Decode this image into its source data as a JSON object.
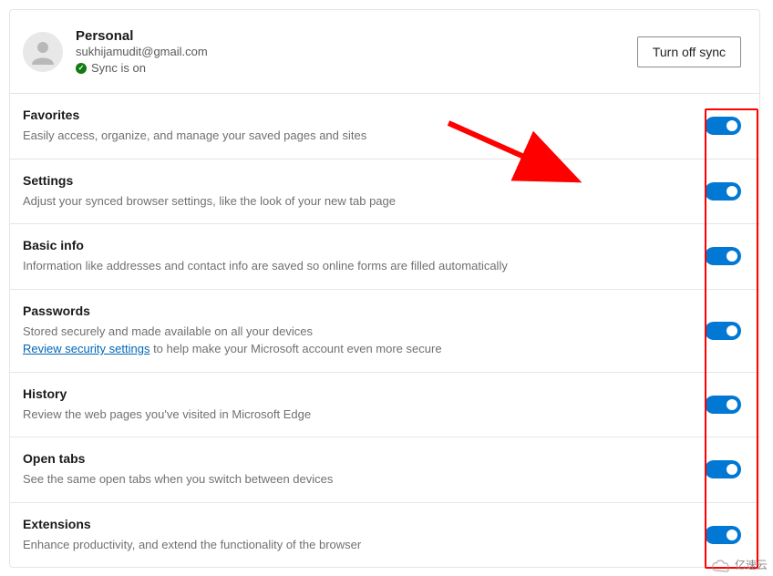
{
  "profile": {
    "name": "Personal",
    "email": "sukhijamudit@gmail.com",
    "sync_status": "Sync is on"
  },
  "turnoff_label": "Turn off sync",
  "sections": [
    {
      "title": "Favorites",
      "desc": "Easily access, organize, and manage your saved pages and sites"
    },
    {
      "title": "Settings",
      "desc": "Adjust your synced browser settings, like the look of your new tab page"
    },
    {
      "title": "Basic info",
      "desc": "Information like addresses and contact info are saved so online forms are filled automatically"
    },
    {
      "title": "Passwords",
      "desc_pre": "Stored securely and made available on all your devices",
      "link": "Review security settings",
      "desc_post": " to help make your Microsoft account even more secure"
    },
    {
      "title": "History",
      "desc": "Review the web pages you've visited in Microsoft Edge"
    },
    {
      "title": "Open tabs",
      "desc": "See the same open tabs when you switch between devices"
    },
    {
      "title": "Extensions",
      "desc": "Enhance productivity, and extend the functionality of the browser"
    }
  ],
  "watermark": "亿速云"
}
